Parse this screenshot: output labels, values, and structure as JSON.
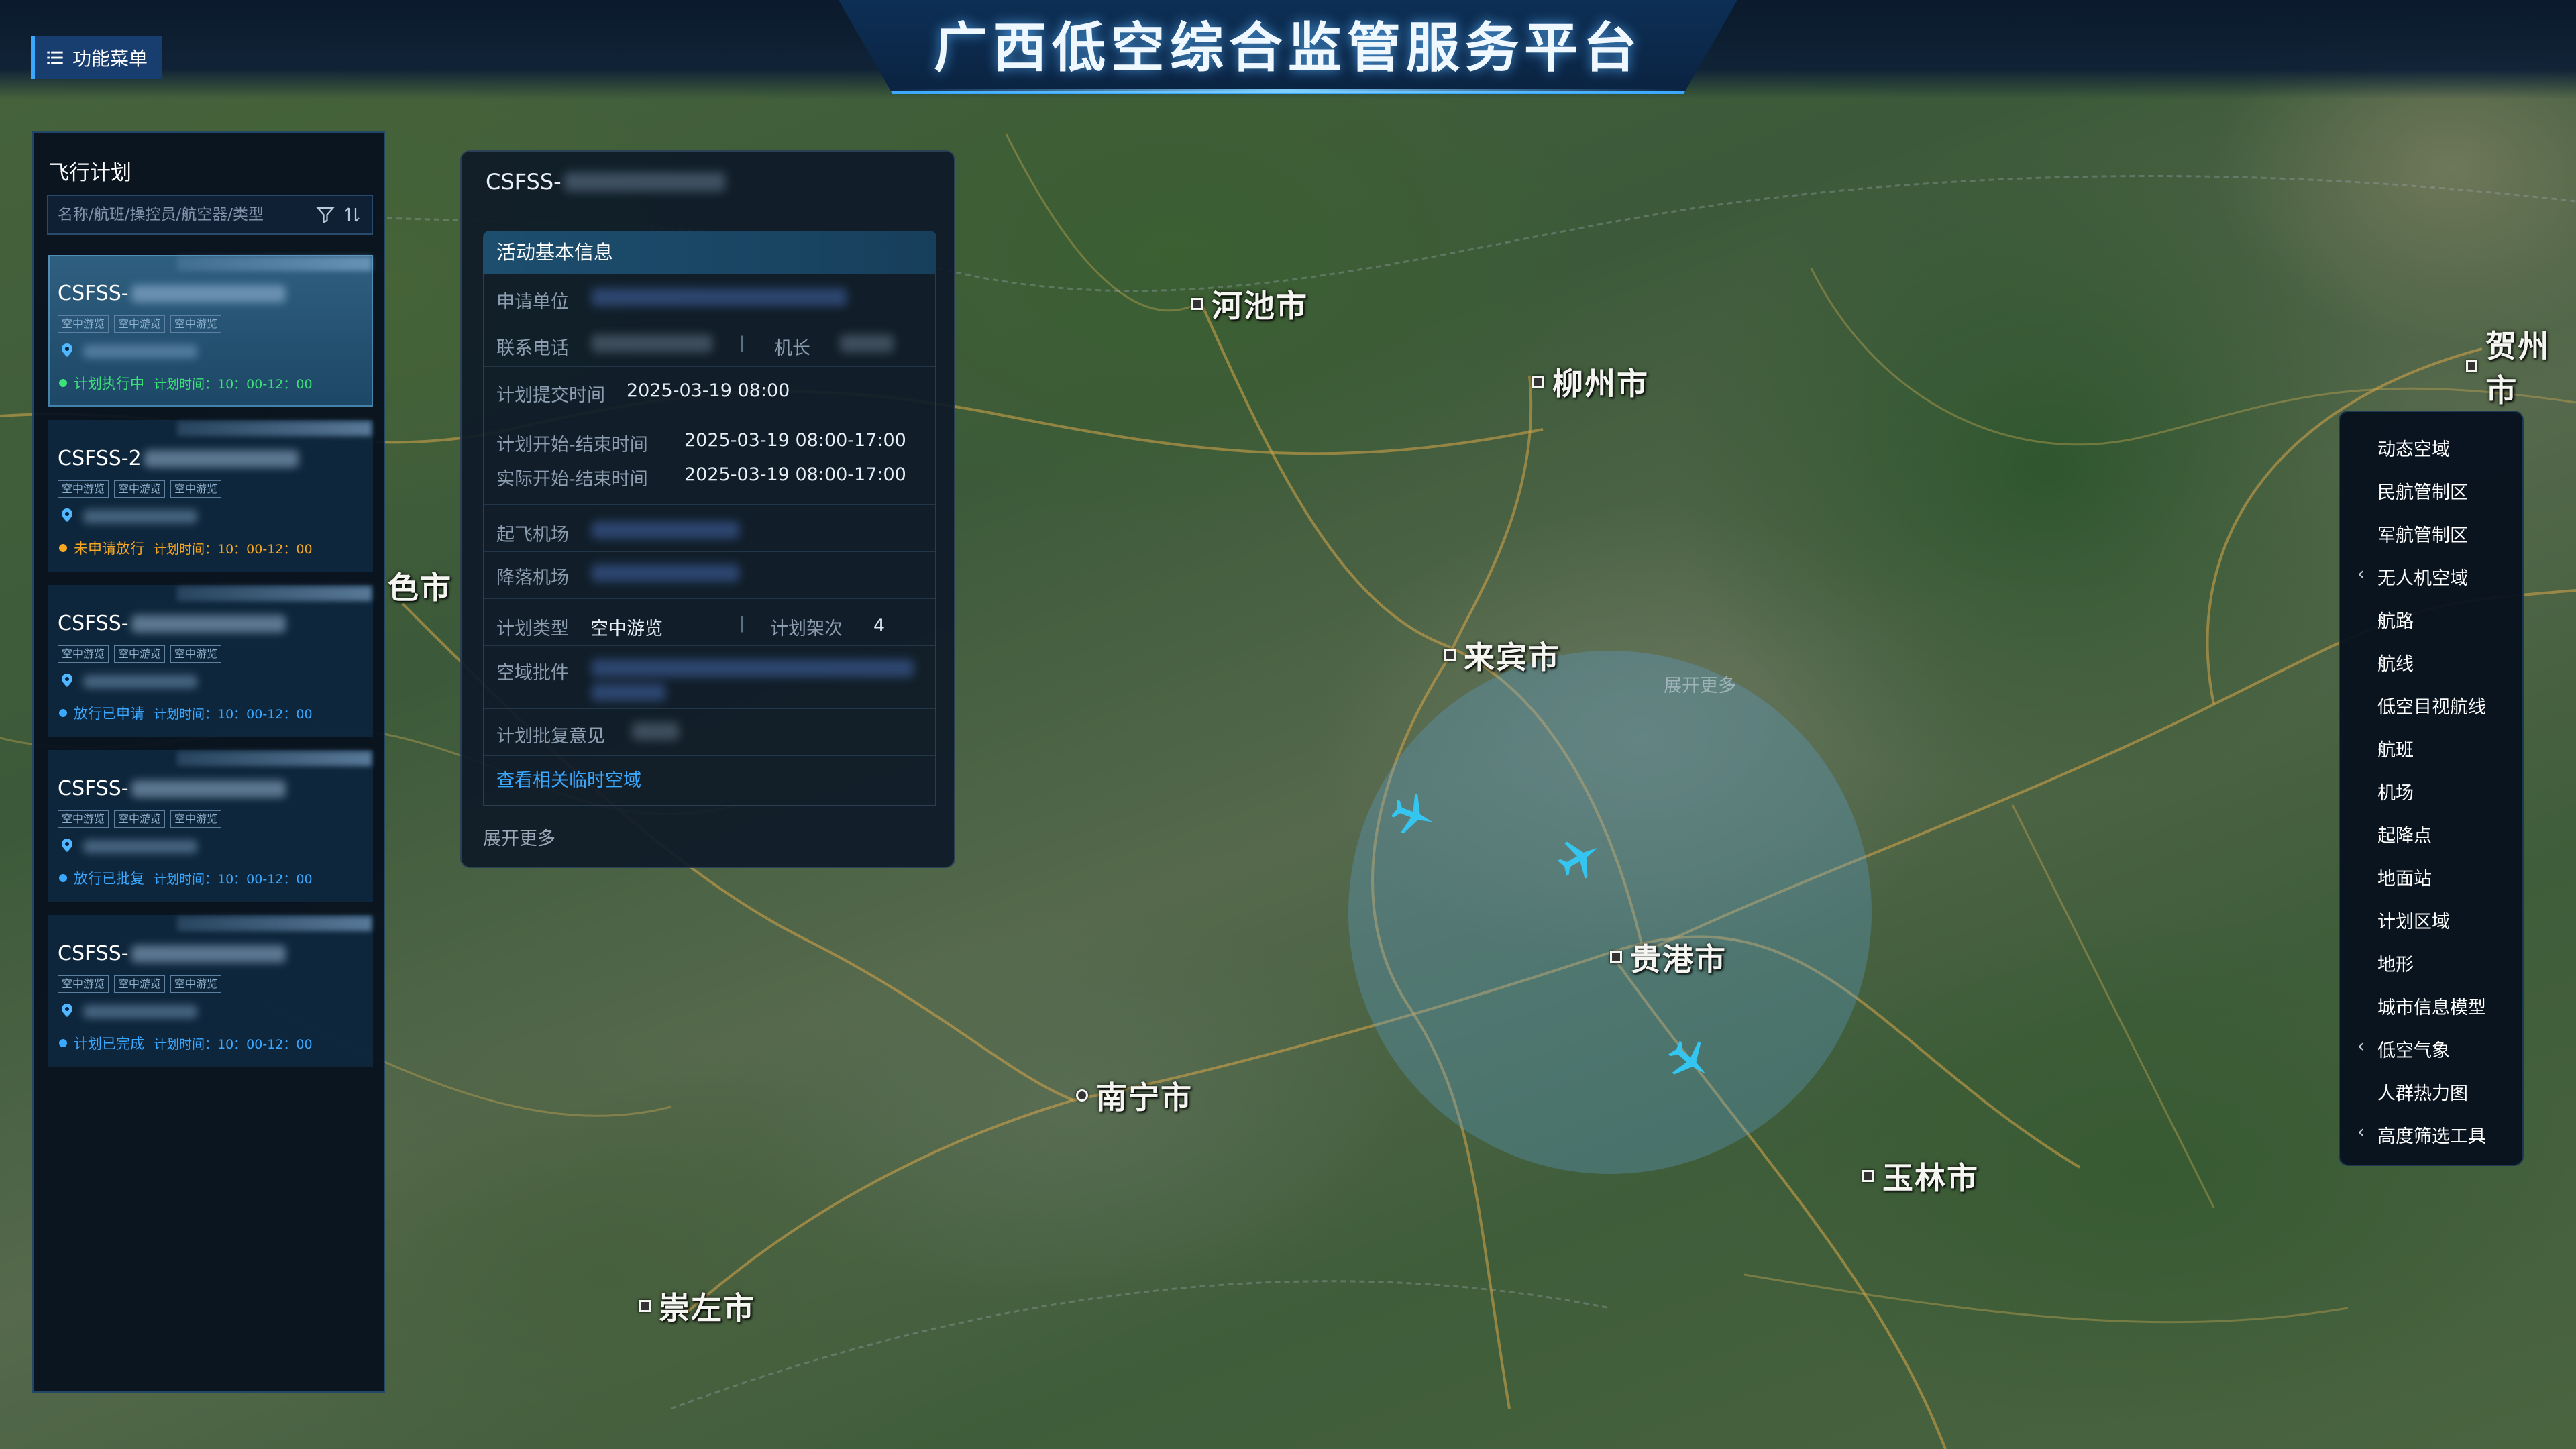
{
  "header": {
    "title": "广西低空综合监管服务平台",
    "menu_label": "功能菜单"
  },
  "flight_plans": {
    "title": "飞行计划",
    "search_placeholder": "名称/航班/操控员/航空器/类型",
    "items": [
      {
        "code_prefix": "CSFSS-",
        "tags": [
          "空中游览",
          "空中游览",
          "空中游览"
        ],
        "status": "计划执行中",
        "time": "计划时间：10：00-12：00",
        "status_color": "#3ee07a",
        "active": true
      },
      {
        "code_prefix": "CSFSS-2",
        "tags": [
          "空中游览",
          "空中游览",
          "空中游览"
        ],
        "status": "未申请放行",
        "time": "计划时间：10：00-12：00",
        "status_color": "#f5a623",
        "active": false
      },
      {
        "code_prefix": "CSFSS-",
        "tags": [
          "空中游览",
          "空中游览",
          "空中游览"
        ],
        "status": "放行已申请",
        "time": "计划时间：10：00-12：00",
        "status_color": "#3aa8ff",
        "active": false
      },
      {
        "code_prefix": "CSFSS-",
        "tags": [
          "空中游览",
          "空中游览",
          "空中游览"
        ],
        "status": "放行已批复",
        "time": "计划时间：10：00-12：00",
        "status_color": "#3aa8ff",
        "active": false
      },
      {
        "code_prefix": "CSFSS-",
        "tags": [
          "空中游览",
          "空中游览",
          "空中游览"
        ],
        "status": "计划已完成",
        "time": "计划时间：10：00-12：00",
        "status_color": "#3aa8ff",
        "active": false
      }
    ]
  },
  "detail": {
    "title_prefix": "CSFSS-",
    "section_title": "活动基本信息",
    "applicant_label": "申请单位",
    "phone_label": "联系电话",
    "captain_label": "机长",
    "submit_time_label": "计划提交时间",
    "submit_time": "2025-03-19 08:00",
    "plan_period_label": "计划开始-结束时间",
    "plan_period": "2025-03-19 08:00-17:00",
    "actual_period_label": "实际开始-结束时间",
    "actual_period": "2025-03-19 08:00-17:00",
    "takeoff_label": "起飞机场",
    "landing_label": "降落机场",
    "plan_type_label": "计划类型",
    "plan_type": "空中游览",
    "sorties_label": "计划架次",
    "sorties": "4",
    "airspace_batch_label": "空域批件",
    "approval_label": "计划批复意见",
    "link_label": "查看相关临时空域",
    "expand_label": "展开更多"
  },
  "map": {
    "cities": [
      "河池市",
      "柳州市",
      "贺州市",
      "来宾市",
      "贵港市",
      "南宁市",
      "玉林市",
      "崇左市",
      "色市"
    ],
    "expand_label": "展开更多"
  },
  "layers": {
    "items": [
      {
        "label": "动态空域",
        "chevron": false
      },
      {
        "label": "民航管制区",
        "chevron": false
      },
      {
        "label": "军航管制区",
        "chevron": false
      },
      {
        "label": "无人机空域",
        "chevron": true
      },
      {
        "label": "航路",
        "chevron": false
      },
      {
        "label": "航线",
        "chevron": false
      },
      {
        "label": "低空目视航线",
        "chevron": false
      },
      {
        "label": "航班",
        "chevron": false
      },
      {
        "label": "机场",
        "chevron": false
      },
      {
        "label": "起降点",
        "chevron": false
      },
      {
        "label": "地面站",
        "chevron": false
      },
      {
        "label": "计划区域",
        "chevron": false
      },
      {
        "label": "地形",
        "chevron": false
      },
      {
        "label": "城市信息模型",
        "chevron": false
      },
      {
        "label": "低空气象",
        "chevron": true
      },
      {
        "label": "人群热力图",
        "chevron": false
      },
      {
        "label": "高度筛选工具",
        "chevron": true
      }
    ]
  },
  "colors": {
    "accent": "#3aa8ff",
    "panel_bg": "#06101e",
    "status_executing": "#3ee07a",
    "status_pending": "#f5a623",
    "status_info": "#3aa8ff"
  }
}
